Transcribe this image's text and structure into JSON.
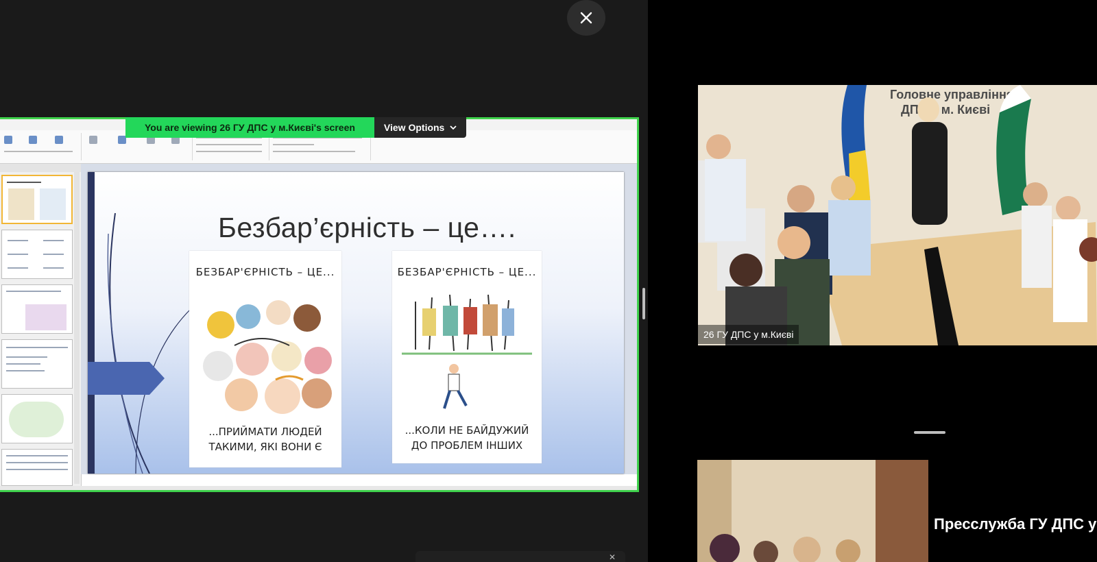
{
  "share": {
    "banner": "You are viewing  26 ГУ ДПС у м.Києві's screen",
    "view_options": "View Options",
    "slide_title": "Безбар’єрність – це….",
    "poster_left_top": "БЕЗБАР'ЄРНІСТЬ – ЦЕ...",
    "poster_left_bottom_1": "...ПРИЙМАТИ ЛЮДЕЙ",
    "poster_left_bottom_2": "ТАКИМИ, ЯКІ ВОНИ Є",
    "poster_right_top": "БЕЗБАР'ЄРНІСТЬ – ЦЕ...",
    "poster_right_bottom_1": "...КОЛИ НЕ БАЙДУЖИЙ",
    "poster_right_bottom_2": "ДО ПРОБЛЕМ ІНШИХ"
  },
  "video_main": {
    "name": "26 ГУ ДПС у м.Києві",
    "sign_line_1": "Головне управління",
    "sign_line_2": "ДПС у м. Києві"
  },
  "video_second": {
    "name": "Пресслужба ГУ ДПС у"
  },
  "icons": [
    "close-icon",
    "chevron-down-icon"
  ],
  "colors": {
    "share_border": "#3fd24c",
    "banner": "#23d75a"
  }
}
